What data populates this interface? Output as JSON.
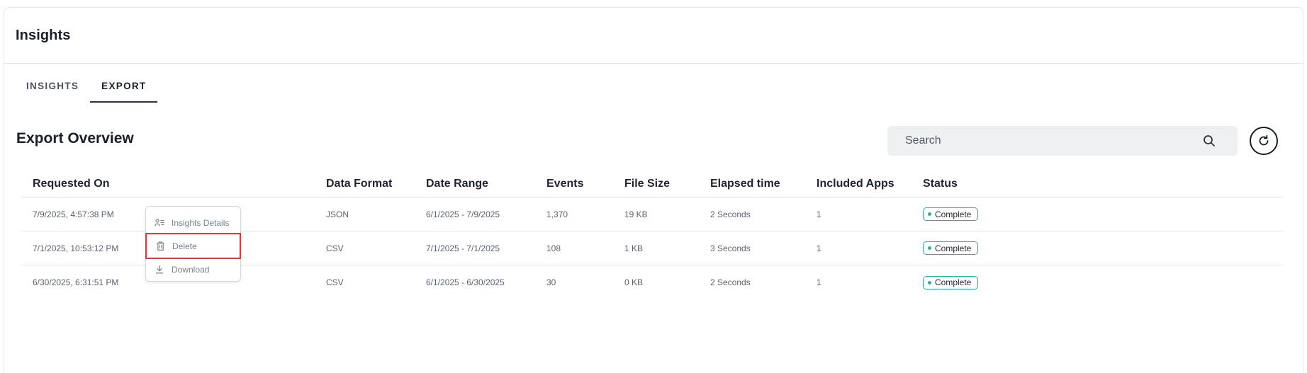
{
  "header": {
    "title": "Insights"
  },
  "tabs": [
    {
      "label": "INSIGHTS",
      "active": false
    },
    {
      "label": "EXPORT",
      "active": true
    }
  ],
  "overview": {
    "title": "Export Overview"
  },
  "search": {
    "placeholder": "Search",
    "value": "",
    "icon": "search-icon"
  },
  "refresh": {
    "icon": "refresh-icon"
  },
  "table": {
    "columns": [
      "Requested On",
      "Data Format",
      "Date Range",
      "Events",
      "File Size",
      "Elapsed time",
      "Included Apps",
      "Status"
    ],
    "rows": [
      {
        "requested_on": "7/9/2025, 4:57:38 PM",
        "data_format": "JSON",
        "date_range": "6/1/2025 - 7/9/2025",
        "events": "1,370",
        "file_size": "19 KB",
        "elapsed": "2 Seconds",
        "apps": "1",
        "status": "Complete"
      },
      {
        "requested_on": "7/1/2025, 10:53:12 PM",
        "data_format": "CSV",
        "date_range": "7/1/2025 - 7/1/2025",
        "events": "108",
        "file_size": "1 KB",
        "elapsed": "3 Seconds",
        "apps": "1",
        "status": "Complete"
      },
      {
        "requested_on": "6/30/2025, 6:31:51 PM",
        "data_format": "CSV",
        "date_range": "6/1/2025 - 6/30/2025",
        "events": "30",
        "file_size": "0 KB",
        "elapsed": "2 Seconds",
        "apps": "1",
        "status": "Complete"
      }
    ]
  },
  "context_menu": {
    "items": [
      {
        "label": "Insights Details",
        "icon": "user-details-icon"
      },
      {
        "label": "Delete",
        "icon": "trash-icon"
      },
      {
        "label": "Download",
        "icon": "download-icon"
      }
    ]
  },
  "colors": {
    "status_accent": "#1fb59a",
    "highlight": "#e0393b",
    "search_bg": "#eef0f2"
  }
}
